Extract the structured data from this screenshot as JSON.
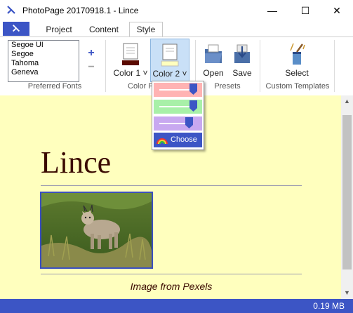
{
  "window": {
    "title": "PhotoPage 20170918.1 - Lince",
    "minimize_glyph": "—",
    "maximize_glyph": "☐",
    "close_glyph": "✕"
  },
  "tabs": [
    {
      "label": "Project",
      "active": false
    },
    {
      "label": "Content",
      "active": false
    },
    {
      "label": "Style",
      "active": true
    }
  ],
  "ribbon": {
    "preferred_fonts": {
      "items": [
        "Segoe UI",
        "Segoe",
        "Tahoma",
        "Geneva"
      ],
      "add_glyph": "+",
      "remove_glyph": "−",
      "label": "Preferred Fonts"
    },
    "color_group": {
      "color1_label": "Color 1 ˅",
      "color2_label": "Color 2 ˅",
      "label": "Color P"
    },
    "presets": {
      "open_label": "Open",
      "save_label": "Save",
      "label": "Presets"
    },
    "custom_templates": {
      "select_label": "Select",
      "label": "Custom Templates"
    }
  },
  "color_popup": {
    "sliders": [
      {
        "color": "#ffb3b3",
        "value": 0.88
      },
      {
        "color": "#a8f0a8",
        "value": 0.88
      },
      {
        "color": "#c8a8f0",
        "value": 0.78
      }
    ],
    "choose_label": "Choose"
  },
  "document": {
    "title": "Lince",
    "caption": "Image from Pexels",
    "background": "#ffffbe"
  },
  "status": {
    "size": "0.19 MB"
  },
  "colors": {
    "accent": "#3c55c5",
    "doc_text": "#3a0a00",
    "color1_swatch": "#5a0a00",
    "color2_swatch": "#ffffbe"
  }
}
